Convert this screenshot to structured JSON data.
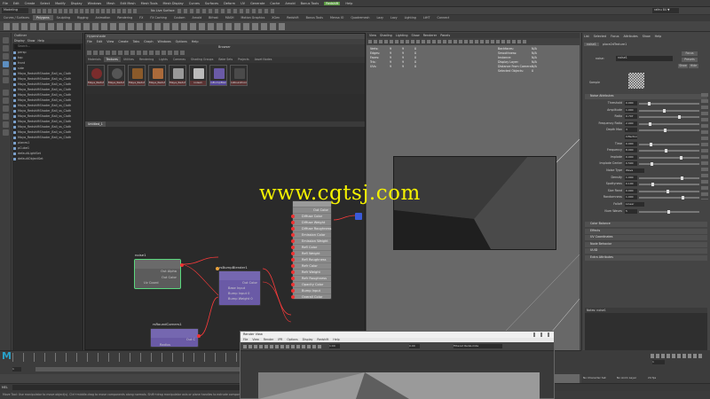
{
  "menubar": {
    "items": [
      "File",
      "Edit",
      "Create",
      "Select",
      "Modify",
      "Display",
      "Windows",
      "Mesh",
      "Edit Mesh",
      "Mesh Tools",
      "Mesh Display",
      "Curves",
      "Surfaces",
      "Deform",
      "UV",
      "Generate",
      "Cache",
      "Arnold",
      "Bonus Tools",
      "Redshift",
      "Help"
    ]
  },
  "toolbar": {
    "workspace": "Modeling",
    "no_live_surface": "No Live Surface",
    "login": "rafeu 84 ▼"
  },
  "shelf": {
    "tabs": [
      "Curves / Surfaces",
      "Polygons",
      "Sculpting",
      "Rigging",
      "Animation",
      "Rendering",
      "FX",
      "FX Caching",
      "Custom",
      "Arnold",
      "Bifrost",
      "MASH",
      "Motion Graphics",
      "XGen",
      "Redshift",
      "Bonus Tools",
      "Mensa IO",
      "Quadremesh",
      "Lazy",
      "Lazy",
      "Lighting",
      "LtHT",
      "Connect"
    ],
    "active": 1
  },
  "outliner": {
    "title": "Outliner",
    "menus": [
      "Display",
      "Show",
      "Help"
    ],
    "search": "Search...",
    "items": [
      "persp",
      "top",
      "front",
      "side",
      "Maya_RedshiftShader_Ball_ss_Cloth",
      "Maya_RedshiftShader_Ball_ss_Cloth",
      "Maya_RedshiftShader_Ball_ss_Cloth",
      "Maya_RedshiftShader_Ball_ss_Cloth",
      "Maya_RedshiftShader_Ball_ss_Cloth",
      "Maya_RedshiftShader_Ball_ss_Cloth",
      "Maya_RedshiftShader_Ball_ss_Cloth",
      "Maya_RedshiftShader_Ball_ss_Cloth",
      "Maya_RedshiftShader_Ball_ss_Cloth",
      "Maya_RedshiftShader_Ball_ss_Cloth",
      "Maya_RedshiftShader_Ball_ss_Cloth",
      "Maya_RedshiftShader_Ball_ss_Cloth",
      "Maya_RedshiftShader_Ball_ss_Cloth",
      "planes1",
      "pCube1",
      "defaultLightSet",
      "defaultObjectSet"
    ]
  },
  "hypershade": {
    "title": "Hypershade",
    "menus": [
      "File",
      "Edit",
      "View",
      "Create",
      "Tabs",
      "Graph",
      "Windows",
      "Options",
      "Help"
    ],
    "browser_label": "Browser",
    "browser_tabs": [
      "Materials",
      "Textures",
      "Utilities",
      "Rendering",
      "Lights",
      "Cameras",
      "Shading Groups",
      "Bake Sets",
      "Projects",
      "Asset Nodes"
    ],
    "active_browser_tab": 1,
    "swatches": [
      "Maya_RedshiftShader",
      "Maya_RedshiftShader",
      "Maya_RedshiftShader",
      "Maya_RedshiftShader",
      "Maya_RedshiftShader",
      "noise1",
      "rsBumpBlender",
      "rsRoundCorners"
    ],
    "graph_tab": "Untitled_1",
    "nodes": {
      "noise": {
        "title": "noise1",
        "rows": [
          "Out Alpha",
          "Out Color",
          "Uv Coord"
        ]
      },
      "bump": {
        "title": "rsBumpBlender1",
        "rows": [
          "Out Color",
          "Base Input",
          "Bump Input 0",
          "Bump Weight 0"
        ]
      },
      "round": {
        "title": "rsRoundCorners1",
        "rows": [
          "Out C",
          "Radius"
        ]
      },
      "material": {
        "title": "RedshiftMaterial1",
        "rows": [
          "Out Color",
          "Diffuse Color",
          "Diffuse Weight",
          "Diffuse Roughness",
          "Emission Color",
          "Emission Weight",
          "Refl Color",
          "Refl Weight",
          "Refl Roughness",
          "Refr Color",
          "Refr Weight",
          "Refr Roughness",
          "Opacity Color",
          "Bump Input",
          "Overall Color"
        ]
      }
    }
  },
  "viewport": {
    "menus": [
      "View",
      "Shading",
      "Lighting",
      "Show",
      "Renderer",
      "Panels"
    ],
    "hud_left": [
      [
        "Verts:",
        "9",
        "9",
        "0"
      ],
      [
        "Edges:",
        "9",
        "9",
        "0"
      ],
      [
        "Faces:",
        "9",
        "9",
        "0"
      ],
      [
        "Tris:",
        "9",
        "9",
        "0"
      ],
      [
        "UVs:",
        "9",
        "9",
        "0"
      ]
    ],
    "hud_right": [
      [
        "Backfaces:",
        "N/A"
      ],
      [
        "Smoothness:",
        "N/A"
      ],
      [
        "Instance:",
        "N/A"
      ],
      [
        "Display Layer:",
        "N/A"
      ],
      [
        "Distance From Camera:",
        "N/A"
      ],
      [
        "Selected Objects:",
        "0"
      ]
    ]
  },
  "attr": {
    "menus": [
      "List",
      "Selected",
      "Focus",
      "Attributes",
      "Show",
      "Help"
    ],
    "tabs": [
      "noise1",
      "place2dTexture1"
    ],
    "type_label": "noise:",
    "type_value": "noise1",
    "focus_btn": "Focus",
    "presets_btn": "Presets",
    "show_btn": "Show",
    "hide_btn": "Hide",
    "sample_label": "Sample",
    "section_noise": "Noise Attributes",
    "rows": [
      [
        "Threshold",
        "0.000"
      ],
      [
        "Amplitude",
        "1.000"
      ],
      [
        "Ratio",
        "0.707"
      ],
      [
        "Frequency Ratio",
        "2.000"
      ],
      [
        "Depth Max",
        "3"
      ],
      [
        "",
        "Inflection"
      ],
      [
        "Time",
        "0.000"
      ],
      [
        "Frequency",
        "8.000"
      ],
      [
        "Implode",
        "0.000"
      ],
      [
        "Implode Center",
        "0.500"
      ],
      [
        "Noise Type",
        "Wave"
      ],
      [
        "Density",
        "1.000"
      ],
      [
        "Spottyness",
        "0.100"
      ],
      [
        "Size Rand",
        "0.000"
      ],
      [
        "Randomness",
        "1.000"
      ],
      [
        "Falloff",
        "Linear"
      ],
      [
        "Num Waves",
        "5"
      ]
    ],
    "sections": [
      "Color Balance",
      "Effects",
      "UV Coordinates",
      "Node Behavior",
      "UUID",
      "Extra Attributes"
    ],
    "notes": "Notes: noise1",
    "bottom_buttons": [
      "Select",
      "Load Attributes",
      "Copy Tab"
    ]
  },
  "timeline": {
    "start": "1",
    "end": "120",
    "frame": "1",
    "fps": "24 fps",
    "character": "No Character Set",
    "anim_layer": "No Anim Layer"
  },
  "cmdline": {
    "lang": "MEL"
  },
  "helpline": "Move Tool: Use manipulator to move object(s). Ctrl+middle-drag to move components along normals. Shift+drag manipulator axis or plane handles to extrude components or clone objects.",
  "renderview": {
    "title": "Render View",
    "menus": [
      "File",
      "View",
      "Render",
      "IPR",
      "Options",
      "Display",
      "Redshift",
      "Help"
    ],
    "zoom": "1:00",
    "camera": "Filtered RedsLimbs",
    "frame": "0.00"
  },
  "watermark": "www.cgtsj.com",
  "logo": "M",
  "colors": {
    "noise_node": "#5c5c5c",
    "noise_border": "#5bd87e",
    "bump_node": "#6a5aa6",
    "material_node": "#8a8a8a",
    "connection": "#d22c2c",
    "watermark": "#f5f200",
    "maya_blue": "#28a0c8"
  }
}
